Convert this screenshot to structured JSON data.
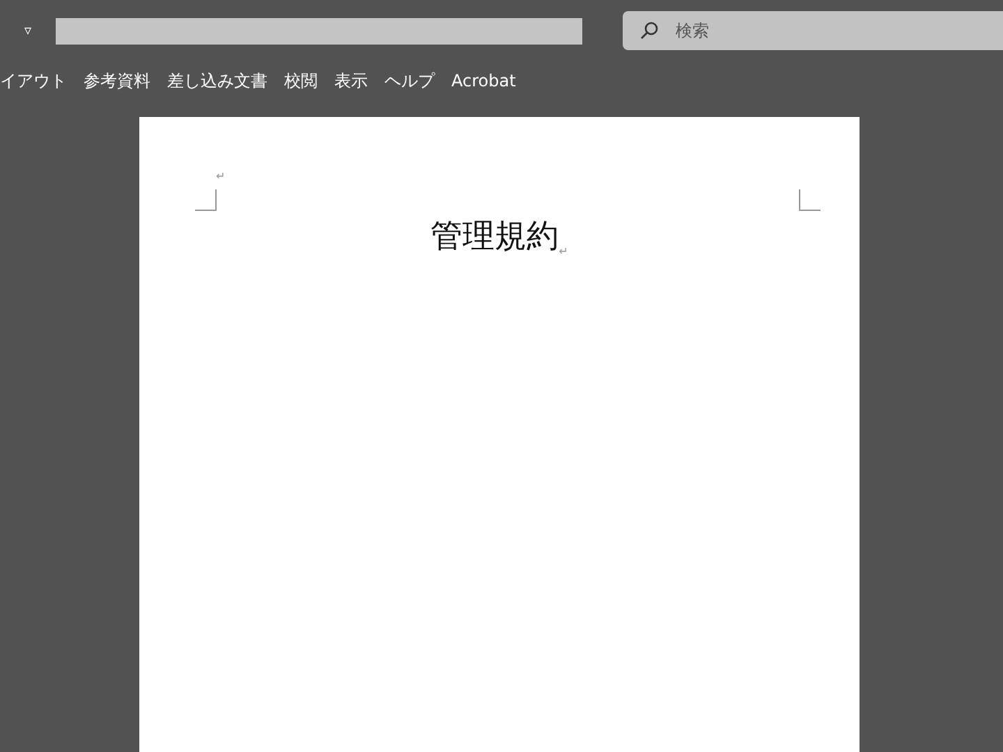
{
  "title_bar": {
    "quick_access_symbol": "▿",
    "search": {
      "placeholder": "検索"
    }
  },
  "ribbon_tabs": [
    {
      "label": "イアウト"
    },
    {
      "label": "参考資料"
    },
    {
      "label": "差し込み文書"
    },
    {
      "label": "校閲"
    },
    {
      "label": "表示"
    },
    {
      "label": "ヘルプ"
    },
    {
      "label": "Acrobat"
    }
  ],
  "document": {
    "empty_paragraph_mark": "↵",
    "heading": "管理規約",
    "heading_mark": "↵"
  }
}
